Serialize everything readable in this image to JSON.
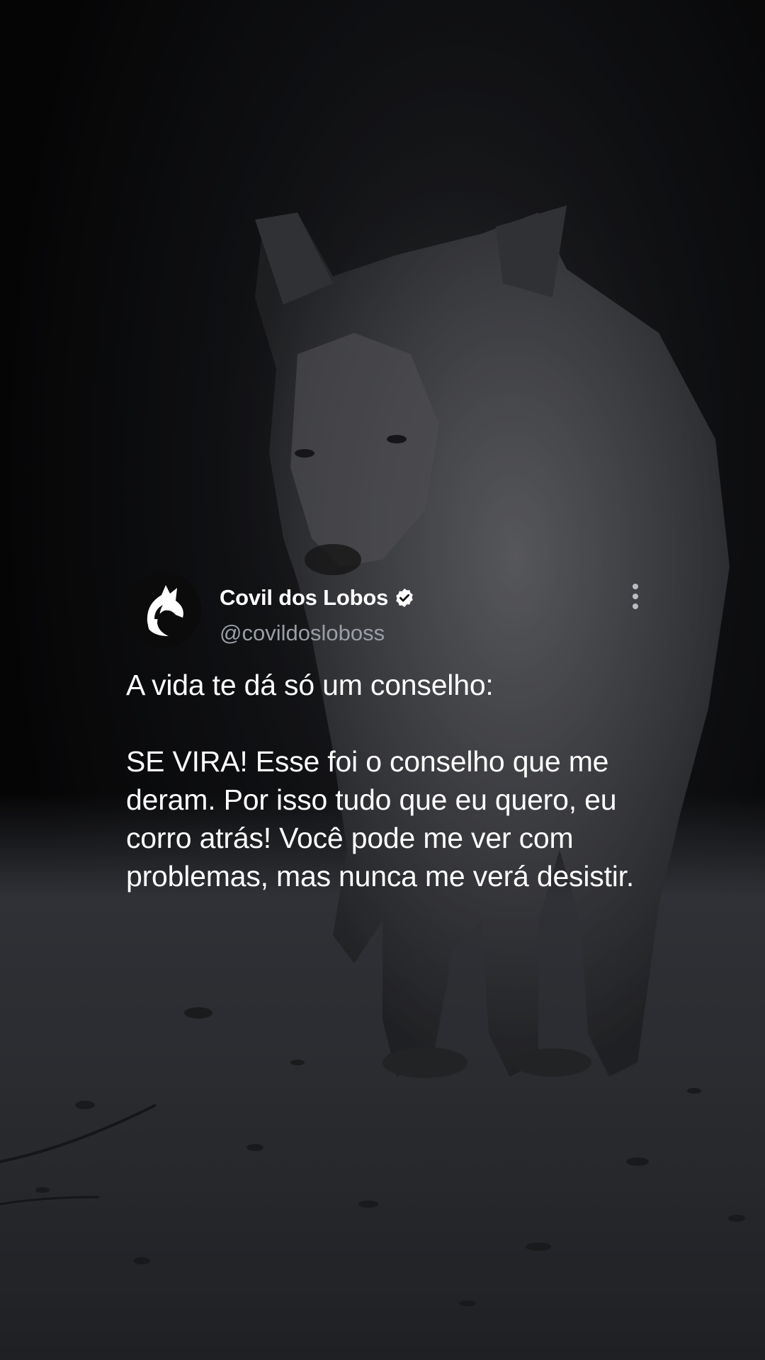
{
  "post": {
    "display_name": "Covil dos Lobos",
    "handle": "@covildosloboss",
    "verified": true,
    "text_intro": "A vida te dá só um conselho:",
    "text_body": "SE VIRA! Esse foi o conselho que me deram. Por isso tudo que eu quero, eu corro atrás! Você pode me ver com problemas, mas nunca me verá desistir."
  },
  "icons": {
    "avatar": "wolf-logo-icon",
    "verified": "verified-badge-icon",
    "more": "more-vertical-icon"
  },
  "colors": {
    "text_primary": "#ffffff",
    "text_secondary": "#9a9ea6",
    "background": "#0a0a0b"
  }
}
